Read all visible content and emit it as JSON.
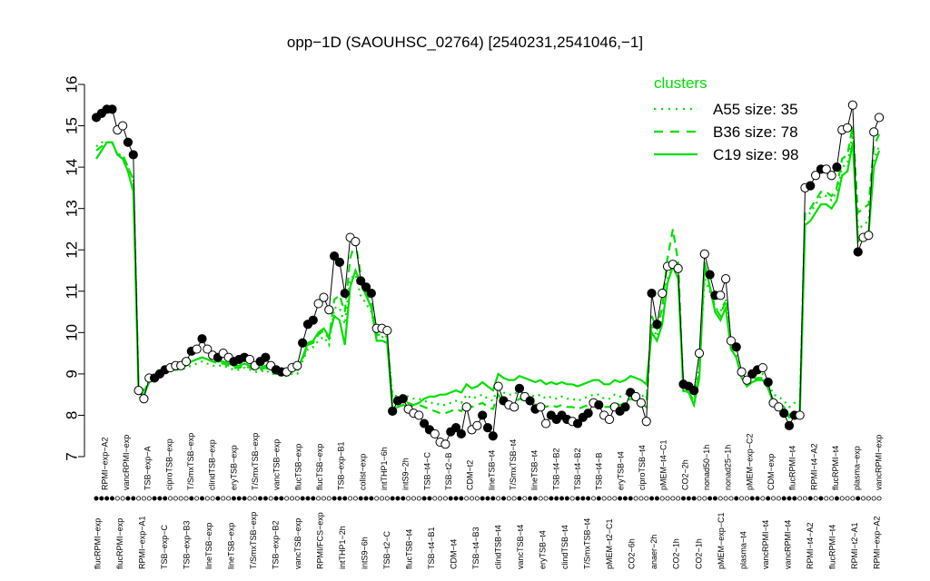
{
  "chart_data": {
    "type": "line",
    "title": "opp−1D (SAOUHSC_02764) [2540231,2541046,−1]",
    "xlabel": "",
    "ylabel": "",
    "ylim": [
      7,
      16
    ],
    "yticks": [
      7,
      8,
      9,
      10,
      11,
      12,
      13,
      14,
      15,
      16
    ],
    "grid": false,
    "legend": {
      "title": "clusters",
      "placement": "top-right",
      "items": [
        {
          "label": "A55 size: 35",
          "style": "dotted"
        },
        {
          "label": "B36 size: 78",
          "style": "dashed"
        },
        {
          "label": "C19 size: 98",
          "style": "solid"
        }
      ]
    },
    "colors": {
      "cluster_lines": "#00e000",
      "points_fill": "#000000",
      "points_open": "#ffffff",
      "sample_line": "#000000"
    },
    "x_tick_labels_bottom": [
      "flucRPMI−exp",
      "flucRPMI−exp",
      "RPMI−exp−A1",
      "TSB−exp−C",
      "TSB−exp−B3",
      "lineTSB−exp",
      "lineTSB−exp",
      "T/SmxTSB−exp",
      "TSB−exp−B2",
      "vancTSB−exp",
      "RPMI/FCS−exp",
      "intTHP1−2h",
      "intS9−6h",
      "TSB−t2−C",
      "flucTSB−t4",
      "TSB−t4−B1",
      "CDM−t4",
      "TSB−t4−B3",
      "clindTSB−t4",
      "vancTSB−t4",
      "eryTSB−t4",
      "clindTSB−t4",
      "T/SmxTSB−t4",
      "pMEM−t2−C1",
      "CO2−6h",
      "anaer−2h",
      "CO2−1h",
      "CO2−1h",
      "pMEM−exp−C1",
      "plasma−t4",
      "vancRPMI−t4",
      "vancRPMI−t4",
      "RPMI−t4−A2",
      "flucRPMI−t4",
      "RPMI−t2−A1",
      "RPMI−exp−A2"
    ],
    "x_tick_labels_top": [
      "RPMI−exp−A2",
      "vancRPMI−exp",
      "TSB−exp−A",
      "ciproTSB−exp",
      "T/SmxTSB−exp",
      "clindTSB−exp",
      "eryTSB−exp",
      "T/SmxTSB−exp",
      "vancTSB−exp",
      "flucTSB−exp",
      "flucTSB−exp",
      "TSB−exp−B1",
      "colist−exp",
      "intTHP1−6h",
      "intS9−2h",
      "TSB−t4−C",
      "TSB−t2−B",
      "CDM−t2",
      "lineTSB−t4",
      "T/SmxTSB−t4",
      "lineTSB−t4",
      "TSB−t4−B2",
      "TSB−t4−B2",
      "TSB−t4−B",
      "eryTSB−t4",
      "ciproTSB−t4",
      "pMEM−t4−C1",
      "CO2−2h",
      "nonad50−1h",
      "nonad25−1h",
      "pMEM−exp−C2",
      "CDM−exp",
      "flucRPMI−t4",
      "RPMI−t4−A2",
      "flucRPMI−t4",
      "plasma−exp",
      "vancRPMI−exp"
    ],
    "series": [
      {
        "name": "",
        "kind": "sample",
        "values": [
          15.2,
          15.3,
          15.4,
          15.4,
          14.9,
          15.0,
          14.6,
          14.3,
          8.6,
          8.4,
          8.9,
          8.9,
          9.0,
          9.1,
          9.15,
          9.2,
          9.2,
          9.3,
          9.55,
          9.6,
          9.85,
          9.6,
          9.45,
          9.4,
          9.5,
          9.4,
          9.3,
          9.35,
          9.4,
          9.35,
          9.2,
          9.3,
          9.4,
          9.2,
          9.1,
          9.05,
          9.05,
          9.15,
          9.2,
          9.75,
          10.2,
          10.3,
          10.7,
          10.85,
          10.55,
          11.85,
          11.7,
          10.95,
          12.3,
          12.2,
          11.25,
          11.1,
          10.95,
          10.1,
          10.1,
          10.05,
          8.1,
          8.35,
          8.4,
          8.15,
          8.05,
          8.0,
          7.8,
          7.65,
          7.55,
          7.35,
          7.3,
          7.6,
          7.7,
          7.55,
          8.2,
          7.65,
          7.75,
          8.0,
          7.7,
          7.5,
          8.7,
          8.35,
          8.25,
          8.2,
          8.65,
          8.45,
          8.35,
          8.15,
          8.2,
          7.8,
          8.0,
          7.9,
          8.0,
          7.9,
          7.85,
          7.8,
          7.95,
          8.05,
          8.3,
          8.25,
          8.0,
          7.9,
          8.2,
          8.1,
          8.2,
          8.55,
          8.45,
          8.3,
          7.85,
          10.95,
          10.2,
          10.95,
          11.6,
          11.65,
          11.55,
          8.75,
          8.7,
          8.6,
          9.5,
          11.9,
          11.4,
          10.9,
          10.9,
          11.3,
          9.8,
          9.65,
          9.05,
          8.85,
          9.0,
          9.1,
          9.15,
          8.8,
          8.3,
          8.2,
          8.05,
          7.75,
          8.0,
          8.0,
          13.5,
          13.55,
          13.8,
          13.95,
          13.95,
          13.8,
          14.0,
          14.9,
          14.95,
          15.5,
          11.95,
          12.3,
          12.35,
          14.85,
          15.2
        ]
      },
      {
        "name": "",
        "kind": "cluster-A55",
        "values": [
          14.5,
          14.6,
          14.6,
          14.6,
          14.3,
          14.3,
          14.0,
          13.7,
          8.7,
          8.6,
          8.8,
          8.9,
          9.0,
          9.05,
          9.1,
          9.1,
          9.1,
          9.15,
          9.2,
          9.25,
          9.3,
          9.25,
          9.2,
          9.2,
          9.2,
          9.15,
          9.1,
          9.1,
          9.15,
          9.1,
          9.05,
          9.05,
          9.1,
          9.0,
          9.0,
          8.95,
          8.95,
          9.0,
          9.0,
          9.3,
          9.6,
          9.65,
          9.8,
          9.9,
          9.7,
          10.6,
          10.6,
          10.2,
          11.3,
          11.4,
          10.9,
          10.7,
          10.5,
          9.9,
          9.9,
          9.8,
          8.5,
          8.45,
          8.5,
          8.45,
          8.4,
          8.4,
          8.35,
          8.3,
          8.3,
          8.25,
          8.25,
          8.3,
          8.35,
          8.3,
          8.5,
          8.4,
          8.45,
          8.5,
          8.4,
          8.35,
          8.7,
          8.55,
          8.5,
          8.5,
          8.6,
          8.55,
          8.5,
          8.45,
          8.5,
          8.4,
          8.45,
          8.4,
          8.45,
          8.4,
          8.4,
          8.35,
          8.4,
          8.45,
          8.5,
          8.5,
          8.4,
          8.4,
          8.5,
          8.45,
          8.5,
          8.6,
          8.55,
          8.5,
          8.4,
          10.2,
          9.9,
          10.3,
          11.3,
          11.6,
          11.3,
          8.7,
          8.7,
          8.5,
          9.2,
          11.3,
          11.0,
          10.6,
          10.5,
          10.8,
          9.7,
          9.5,
          9.0,
          8.85,
          8.95,
          9.0,
          9.0,
          8.8,
          8.5,
          8.45,
          8.35,
          8.2,
          8.3,
          8.3,
          12.8,
          12.9,
          13.1,
          13.3,
          13.3,
          13.2,
          13.4,
          14.0,
          14.1,
          14.8,
          12.5,
          12.6,
          12.7,
          14.2,
          14.5
        ]
      },
      {
        "name": "",
        "kind": "cluster-B36",
        "values": [
          14.4,
          14.5,
          14.6,
          14.6,
          14.3,
          14.3,
          14.0,
          13.7,
          8.7,
          8.6,
          8.8,
          8.9,
          9.0,
          9.05,
          9.1,
          9.1,
          9.15,
          9.2,
          9.3,
          9.35,
          9.4,
          9.35,
          9.3,
          9.25,
          9.25,
          9.2,
          9.15,
          9.15,
          9.2,
          9.15,
          9.1,
          9.1,
          9.15,
          9.05,
          9.0,
          9.0,
          9.0,
          9.05,
          9.05,
          9.35,
          9.7,
          9.75,
          9.95,
          10.05,
          9.85,
          10.8,
          10.9,
          10.5,
          11.8,
          12.2,
          11.4,
          11.0,
          10.7,
          9.95,
          9.95,
          9.9,
          8.35,
          8.3,
          8.35,
          8.3,
          8.25,
          8.25,
          8.2,
          8.15,
          8.1,
          8.05,
          8.05,
          8.1,
          8.15,
          8.1,
          8.3,
          8.2,
          8.25,
          8.3,
          8.2,
          8.15,
          8.5,
          8.35,
          8.3,
          8.3,
          8.4,
          8.35,
          8.3,
          8.25,
          8.3,
          8.2,
          8.25,
          8.2,
          8.25,
          8.2,
          8.2,
          8.15,
          8.2,
          8.25,
          8.3,
          8.3,
          8.2,
          8.2,
          8.3,
          8.25,
          8.3,
          8.4,
          8.35,
          8.3,
          8.2,
          10.4,
          10.1,
          10.6,
          11.8,
          12.5,
          11.7,
          8.55,
          8.55,
          8.35,
          9.1,
          11.6,
          11.1,
          10.6,
          10.4,
          10.8,
          9.6,
          9.4,
          8.9,
          8.75,
          8.85,
          8.9,
          8.9,
          8.7,
          8.35,
          8.3,
          8.2,
          8.0,
          8.1,
          8.1,
          12.9,
          13.0,
          13.2,
          13.4,
          13.4,
          13.3,
          13.5,
          14.2,
          14.3,
          15.0,
          12.9,
          13.0,
          13.1,
          14.5,
          14.8
        ]
      },
      {
        "name": "",
        "kind": "cluster-C19",
        "values": [
          14.2,
          14.4,
          14.6,
          14.6,
          14.3,
          14.2,
          13.9,
          13.4,
          8.6,
          8.5,
          8.8,
          8.95,
          9.05,
          9.1,
          9.15,
          9.15,
          9.2,
          9.25,
          9.3,
          9.35,
          9.4,
          9.35,
          9.3,
          9.3,
          9.3,
          9.25,
          9.2,
          9.2,
          9.25,
          9.2,
          9.15,
          9.15,
          9.2,
          9.1,
          9.05,
          9.05,
          9.05,
          9.1,
          9.1,
          9.4,
          9.75,
          9.8,
          10.0,
          10.1,
          9.9,
          10.4,
          10.3,
          9.7,
          11.1,
          11.5,
          11.2,
          10.9,
          10.6,
          9.8,
          9.8,
          9.75,
          8.15,
          8.2,
          8.25,
          8.2,
          8.25,
          8.3,
          8.4,
          8.45,
          8.45,
          8.5,
          8.5,
          8.55,
          8.6,
          8.55,
          8.75,
          8.65,
          8.7,
          8.8,
          8.7,
          8.6,
          9.0,
          8.9,
          8.85,
          8.85,
          8.95,
          8.9,
          8.85,
          8.8,
          8.85,
          8.75,
          8.8,
          8.75,
          8.8,
          8.75,
          8.75,
          8.7,
          8.75,
          8.8,
          8.85,
          8.85,
          8.75,
          8.75,
          8.85,
          8.8,
          8.85,
          8.95,
          8.9,
          8.85,
          8.75,
          10.0,
          9.8,
          10.2,
          11.2,
          11.6,
          11.3,
          8.6,
          8.55,
          8.25,
          8.9,
          11.7,
          11.1,
          10.5,
          10.3,
          10.6,
          9.6,
          9.4,
          8.9,
          8.7,
          8.8,
          8.85,
          8.85,
          8.65,
          8.3,
          8.25,
          8.1,
          7.95,
          8.0,
          8.0,
          12.6,
          12.7,
          12.9,
          13.1,
          13.1,
          13.0,
          13.2,
          13.8,
          13.9,
          14.6,
          12.2,
          12.3,
          12.4,
          14.0,
          14.4
        ]
      }
    ],
    "markers": [
      1,
      1,
      1,
      1,
      0,
      0,
      1,
      1,
      0,
      0,
      0,
      1,
      1,
      1,
      0,
      0,
      0,
      0,
      1,
      0,
      1,
      0,
      0,
      1,
      0,
      0,
      1,
      1,
      1,
      0,
      0,
      1,
      1,
      0,
      1,
      1,
      0,
      0,
      0,
      1,
      1,
      1,
      0,
      0,
      0,
      1,
      1,
      1,
      0,
      0,
      1,
      1,
      1,
      0,
      0,
      0,
      1,
      1,
      1,
      0,
      0,
      0,
      1,
      1,
      0,
      0,
      0,
      1,
      1,
      1,
      0,
      0,
      0,
      1,
      1,
      1,
      0,
      1,
      0,
      0,
      1,
      0,
      1,
      1,
      0,
      0,
      1,
      1,
      1,
      1,
      0,
      1,
      1,
      1,
      0,
      1,
      0,
      0,
      0,
      1,
      1,
      1,
      0,
      0,
      0,
      1,
      1,
      0,
      0,
      0,
      0,
      1,
      1,
      1,
      0,
      0,
      1,
      1,
      0,
      0,
      0,
      1,
      0,
      0,
      1,
      1,
      0,
      1,
      0,
      0,
      1,
      1,
      1,
      0,
      0,
      1,
      0,
      1,
      0,
      0,
      1,
      0,
      0,
      0,
      1,
      0
    ]
  }
}
